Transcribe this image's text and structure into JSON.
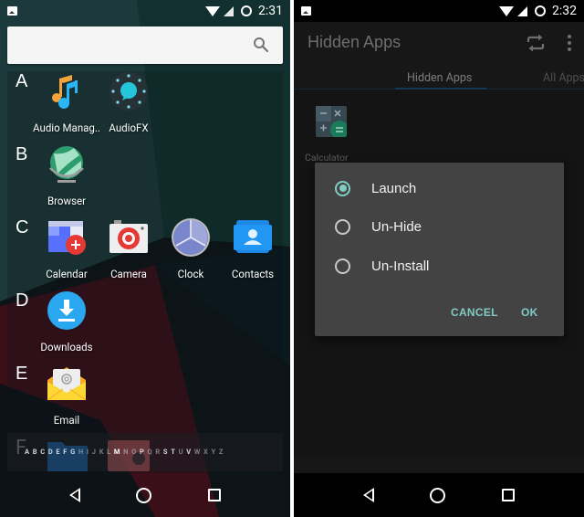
{
  "left_screen": {
    "status_bar": {
      "time": "2:31",
      "icons": [
        "image-notification-icon",
        "wifi-icon",
        "signal-icon",
        "battery-icon"
      ]
    },
    "search": {
      "placeholder": "",
      "icon": "search-icon"
    },
    "sections": [
      {
        "letter": "A",
        "apps": [
          {
            "label": "Audio Manag..",
            "icon": "audio-manager-icon"
          },
          {
            "label": "AudioFX",
            "icon": "audiofx-icon"
          }
        ]
      },
      {
        "letter": "B",
        "apps": [
          {
            "label": "Browser",
            "icon": "browser-icon"
          }
        ]
      },
      {
        "letter": "C",
        "apps": [
          {
            "label": "Calendar",
            "icon": "calendar-icon"
          },
          {
            "label": "Camera",
            "icon": "camera-icon"
          },
          {
            "label": "Clock",
            "icon": "clock-icon"
          },
          {
            "label": "Contacts",
            "icon": "contacts-icon"
          }
        ]
      },
      {
        "letter": "D",
        "apps": [
          {
            "label": "Downloads",
            "icon": "downloads-icon"
          }
        ]
      },
      {
        "letter": "E",
        "apps": [
          {
            "label": "Email",
            "icon": "email-icon"
          }
        ]
      },
      {
        "letter": "F",
        "apps": []
      }
    ],
    "alphabet_scrubber": [
      "A",
      "B",
      "C",
      "D",
      "E",
      "F",
      "G",
      "H",
      "I",
      "J",
      "K",
      "L",
      "M",
      "N",
      "O",
      "P",
      "Q",
      "R",
      "S",
      "T",
      "U",
      "V",
      "W",
      "X",
      "Y",
      "Z"
    ],
    "navbar": {
      "back": "back-icon",
      "home": "home-icon",
      "recents": "recents-icon"
    }
  },
  "right_screen": {
    "status_bar": {
      "time": "2:32"
    },
    "appbar": {
      "title": "Hidden Apps",
      "actions": [
        "swap-icon",
        "overflow-menu-icon"
      ]
    },
    "tabs": [
      {
        "label": "Hidden Apps",
        "active": true
      },
      {
        "label": "All Apps",
        "active": false
      }
    ],
    "hidden_apps": [
      {
        "label": "Calculator",
        "icon": "calculator-icon"
      }
    ],
    "dialog": {
      "options": [
        {
          "label": "Launch",
          "checked": true
        },
        {
          "label": "Un-Hide",
          "checked": false
        },
        {
          "label": "Un-Install",
          "checked": false
        }
      ],
      "cancel_label": "CANCEL",
      "ok_label": "OK"
    },
    "navbar": {
      "back": "back-icon",
      "home": "home-icon",
      "recents": "recents-icon"
    }
  },
  "colors": {
    "accent": "#80cbc4",
    "dialog_bg": "#434343",
    "tab_indicator": "#123a54",
    "appbar_bg": "#171717"
  }
}
